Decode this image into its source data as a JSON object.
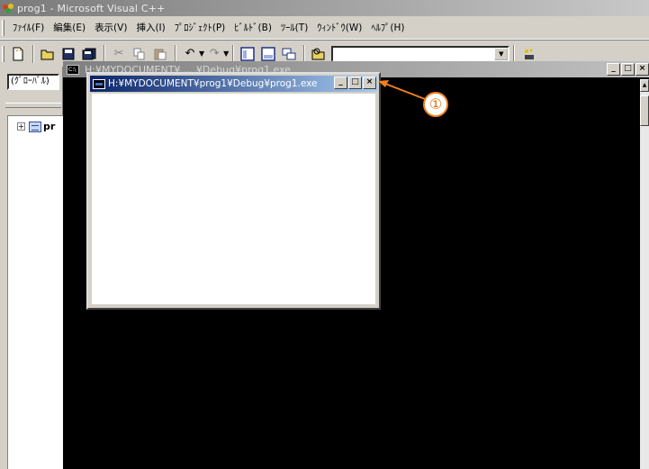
{
  "app": {
    "title": "prog1 - Microsoft Visual C++",
    "icon": "visual-cpp-icon"
  },
  "menu": {
    "items": [
      "ﾌｧｲﾙ(F)",
      "編集(E)",
      "表示(V)",
      "挿入(I)",
      "ﾌﾟﾛｼﾞｪｸﾄ(P)",
      "ﾋﾞﾙﾄﾞ(B)",
      "ﾂｰﾙ(T)",
      "ｳｨﾝﾄﾞｳ(W)",
      "ﾍﾙﾌﾟ(H)"
    ]
  },
  "toolbar": {
    "combo_value": "",
    "icons": [
      "new-file-icon",
      "open-folder-icon",
      "save-icon",
      "save-all-icon",
      "cut-icon",
      "copy-icon",
      "paste-icon",
      "undo-icon",
      "redo-icon",
      "workspace-icon",
      "output-icon",
      "windows-list-icon",
      "find-in-files-icon",
      "find-icon",
      "wizard-icon"
    ]
  },
  "workspace": {
    "scope_combo": "(ｸﾞﾛｰﾊﾞﾙ)",
    "tree_item": "pr"
  },
  "console_window": {
    "title": "H:¥MYDOCUMENT¥ ... ¥Debug¥prog1.exe",
    "background": "#000000"
  },
  "prog_window": {
    "title": "H:¥MYDOCUMENT¥prog1¥Debug¥prog1.exe",
    "titlebar_color": "#0a246a"
  },
  "window_controls": {
    "minimize": "_",
    "maximize": "□",
    "close": "×"
  },
  "callout": {
    "label": "①",
    "color": "#f08020"
  }
}
